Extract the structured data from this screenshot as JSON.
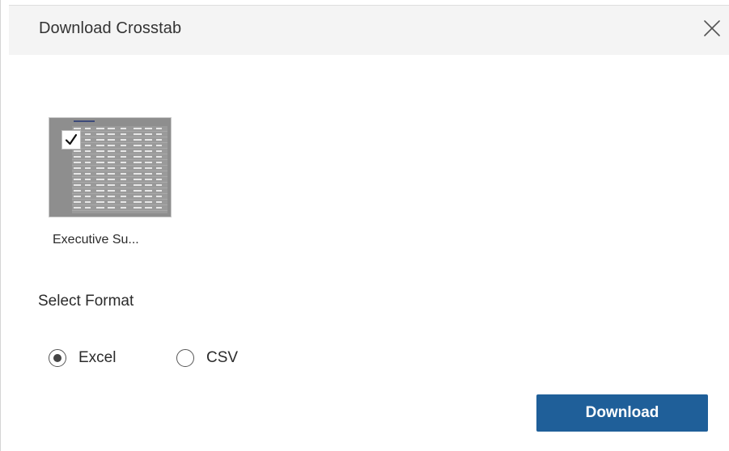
{
  "dialog": {
    "title": "Download Crosstab",
    "close_icon": "close-icon"
  },
  "sheets": [
    {
      "label": "Executive Su...",
      "selected": true,
      "thumbnail_icon": "crosstab-thumbnail"
    }
  ],
  "format": {
    "label": "Select Format",
    "options": [
      {
        "label": "Excel",
        "selected": true
      },
      {
        "label": "CSV",
        "selected": false
      }
    ]
  },
  "actions": {
    "download_label": "Download"
  },
  "colors": {
    "primary_button": "#1f5f99",
    "header_background": "#f4f4f4",
    "thumbnail_background": "#8e8e8e"
  }
}
